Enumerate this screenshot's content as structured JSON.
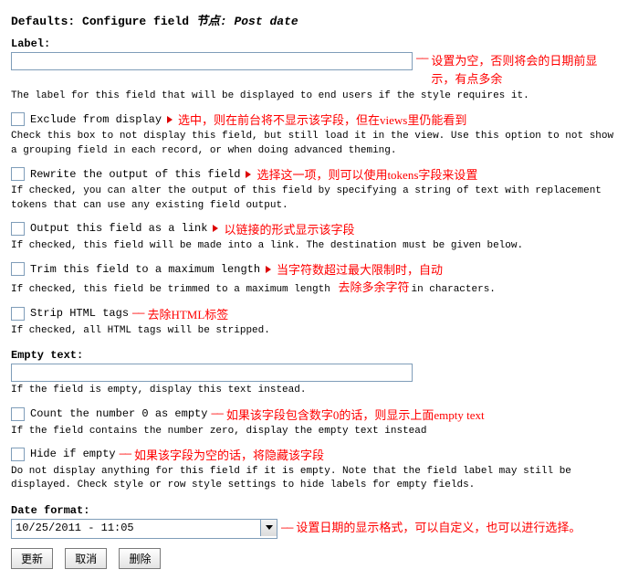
{
  "title_prefix": "Defaults: Configure field ",
  "title_node": "节点:",
  "title_field": " Post date",
  "label": {
    "heading": "Label:",
    "value": "",
    "help": "The label for this field that will be displayed to end users if the style requires it.",
    "anno": "设置为空，否则将会的日期前显示，有点多余"
  },
  "exclude": {
    "label": "Exclude from display",
    "anno": "选中，则在前台将不显示该字段，但在views里仍能看到",
    "help": "Check this box to not display this field, but still load it in the view. Use this option to not show a grouping field in each record, or when doing advanced theming."
  },
  "rewrite": {
    "label": "Rewrite the output of this field",
    "anno": "选择这一项，则可以使用tokens字段来设置",
    "help": "If checked, you can alter the output of this field by specifying a string of text with replacement tokens that can use any existing field output."
  },
  "aslink": {
    "label": "Output this field as a link",
    "anno": "以链接的形式显示该字段",
    "help": "If checked, this field will be made into a link. The destination must be given below."
  },
  "trim": {
    "label": "Trim this field to a maximum length",
    "anno1": "当字符数超过最大限制时，自动",
    "help_a": "If checked, this field be trimmed to a maximum length",
    "help_b": "in characters.",
    "anno2": "去除多余字符"
  },
  "strip": {
    "label": "Strip HTML tags",
    "anno": "去除HTML标签",
    "help": "If checked, all HTML tags will be stripped."
  },
  "empty": {
    "heading": "Empty text:",
    "value": "",
    "help": "If the field is empty, display this text instead."
  },
  "countzero": {
    "label": "Count the number 0 as empty",
    "anno": "如果该字段包含数字0的话，则显示上面empty text",
    "help": "If the field contains the number zero, display the empty text instead"
  },
  "hideempty": {
    "label": "Hide if empty",
    "anno": "如果该字段为空的话，将隐藏该字段",
    "help": "Do not display anything for this field if it is empty. Note that the field label may still be displayed. Check style or row style settings to hide labels for empty fields."
  },
  "dateformat": {
    "heading": "Date format:",
    "value": "10/25/2011 - 11:05",
    "anno": "设置日期的显示格式，可以自定义，也可以进行选择。"
  },
  "buttons": {
    "update": "更新",
    "cancel": "取消",
    "delete": "删除"
  }
}
